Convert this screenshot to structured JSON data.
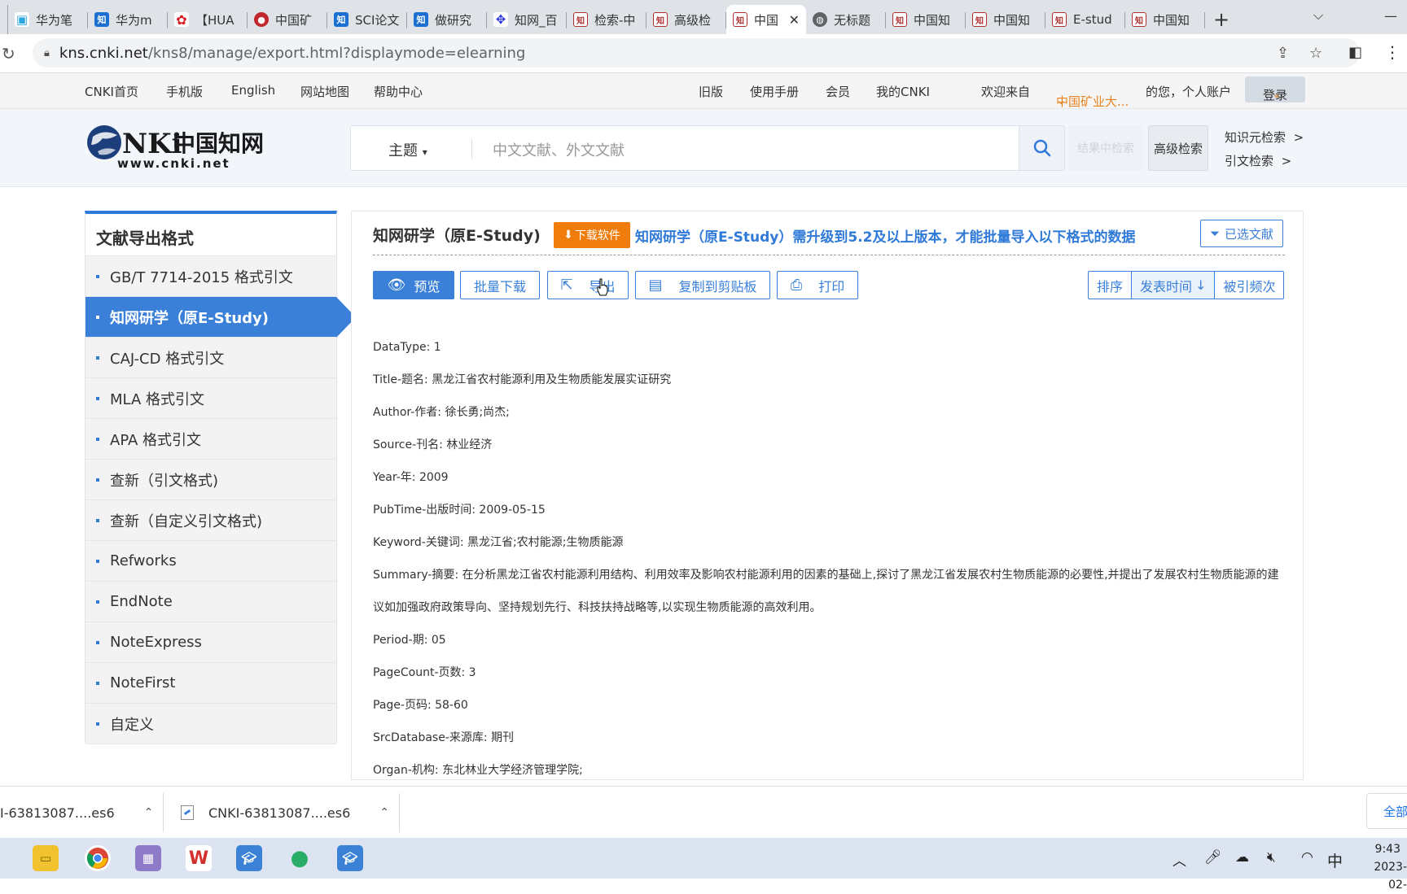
{
  "browser": {
    "tabs": [
      {
        "label": "华为笔",
        "favicon": "bilibili-icon"
      },
      {
        "label": "华为m",
        "favicon": "zhihu-icon"
      },
      {
        "label": "【HUA",
        "favicon": "huawei-icon"
      },
      {
        "label": "中国矿",
        "favicon": "university-seal-icon"
      },
      {
        "label": "SCI论文",
        "favicon": "zhihu-icon"
      },
      {
        "label": "做研究",
        "favicon": "zhihu-icon"
      },
      {
        "label": "知网_百",
        "favicon": "baidu-icon"
      },
      {
        "label": "检索-中",
        "favicon": "cnki-icon"
      },
      {
        "label": "高级检",
        "favicon": "cnki-icon"
      },
      {
        "label": "中国",
        "favicon": "cnki-icon",
        "active": true
      },
      {
        "label": "无标题",
        "favicon": "globe-icon"
      },
      {
        "label": "中国知",
        "favicon": "cnki-icon"
      },
      {
        "label": "中国知",
        "favicon": "cnki-icon"
      },
      {
        "label": "E-stud",
        "favicon": "cnki-icon"
      },
      {
        "label": "中国知",
        "favicon": "cnki-icon"
      }
    ],
    "url_host": "kns.cnki.net",
    "url_path": "/kns8/manage/export.html?displaymode=elearning"
  },
  "topnav": {
    "home": "CNKI首页",
    "mobile": "手机版",
    "english": "English",
    "sitemap": "网站地图",
    "help": "帮助中心",
    "old": "旧版",
    "manual": "使用手册",
    "member": "会员",
    "mycnki": "我的CNKI",
    "welcome": "欢迎来自",
    "org": "中国矿业大...",
    "account": "的您，个人账户",
    "login": "登录"
  },
  "search": {
    "type": "主题",
    "placeholder": "中文文献、外文文献",
    "result_search": "结果中检索",
    "advanced": "高级检索",
    "knowledge": "知识元检索",
    "citation": "引文检索"
  },
  "sidebar": {
    "title": "文献导出格式",
    "items": [
      {
        "label": "GB/T 7714-2015 格式引文"
      },
      {
        "label": "知网研学（原E-Study)",
        "active": true
      },
      {
        "label": "CAJ-CD 格式引文"
      },
      {
        "label": "MLA 格式引文"
      },
      {
        "label": "APA 格式引文"
      },
      {
        "label": "查新（引文格式)"
      },
      {
        "label": "查新（自定义引文格式)"
      },
      {
        "label": "Refworks"
      },
      {
        "label": "EndNote"
      },
      {
        "label": "NoteExpress"
      },
      {
        "label": "NoteFirst"
      },
      {
        "label": "自定义"
      }
    ]
  },
  "main": {
    "title": "知网研学（原E-Study)",
    "download_software": "下载软件",
    "notice": "知网研学（原E-Study）需升级到5.2及以上版本，才能批量导入以下格式的数据",
    "selected_docs": "已选文献",
    "toolbar": {
      "preview": "预览",
      "batch_download": "批量下载",
      "export": "导出",
      "copy": "复制到剪贴板",
      "print": "打印",
      "sort": "排序",
      "sort_pubtime": "发表时间",
      "sort_cited": "被引频次"
    },
    "record": [
      "DataType: 1",
      "Title-题名: 黑龙江省农村能源利用及生物质能发展实证研究",
      "Author-作者: 徐长勇;尚杰;",
      "Source-刊名: 林业经济",
      "Year-年: 2009",
      "PubTime-出版时间: 2009-05-15",
      "Keyword-关键词: 黑龙江省;农村能源;生物质能源",
      "Summary-摘要: 在分析黑龙江省农村能源利用结构、利用效率及影响农村能源利用的因素的基础上,探讨了黑龙江省发展农村生物质能源的必要性,并提出了发展农村生物质能源的建议如加强政府政策导向、坚持规划先行、科技扶持战略等,以实现生物质能源的高效利用。",
      "Period-期: 05",
      "PageCount-页数: 3",
      "Page-页码: 58-60",
      "SrcDatabase-来源库: 期刊",
      "Organ-机构: 东北林业大学经济管理学院;"
    ]
  },
  "downloads": {
    "item1": "I-63813087....es6",
    "item2": "CNKI-63813087....es6",
    "all": "全部"
  },
  "taskbar": {
    "ime": "中",
    "time": "9:43",
    "date": "2023-02-"
  },
  "colors": {
    "cnki_blue": "#3a80d9",
    "accent_orange": "#f07c0c"
  }
}
